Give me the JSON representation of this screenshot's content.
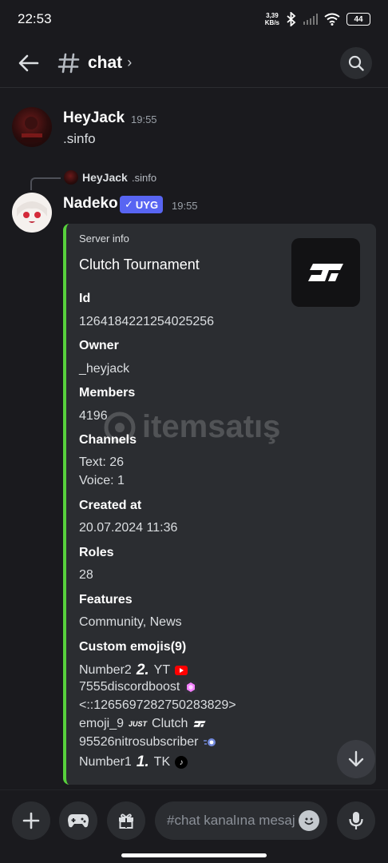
{
  "status_bar": {
    "time": "22:53",
    "net_speed_value": "3,39",
    "net_speed_unit": "KB/s",
    "battery": "44"
  },
  "header": {
    "channel_name": "chat",
    "chevron": "›"
  },
  "messages": {
    "jack": {
      "username": "HeyJack",
      "time": "19:55",
      "text": ".sinfo"
    },
    "reply": {
      "username": "HeyJack",
      "text": ".sinfo"
    },
    "nadeko": {
      "username": "Nadeko",
      "badge": "UYG",
      "badge_check": "✓",
      "time": "19:55"
    }
  },
  "embed": {
    "author": "Server info",
    "title": "Clutch Tournament",
    "fields": {
      "id_name": "Id",
      "id_value": "1264184221254025256",
      "owner_name": "Owner",
      "owner_value": "_heyjack",
      "members_name": "Members",
      "members_value": "4196",
      "channels_name": "Channels",
      "channels_text": "Text: 26",
      "channels_voice": "Voice: 1",
      "created_name": "Created at",
      "created_value": "20.07.2024 11:36",
      "roles_name": "Roles",
      "roles_value": "28",
      "features_name": "Features",
      "features_value": "Community, News",
      "emojis_name": "Custom emojis(9)"
    },
    "emoji_lines": {
      "l1_name": "Number2",
      "l1_glyph": "2.",
      "l1_label": "YT",
      "l2_name": "7555discordboost",
      "l3_text": "<::1265697282750283829>",
      "l4_name": "emoji_9",
      "l4_glyph": "JUST",
      "l4_label": "Clutch",
      "l5_name": "95526nitrosubscriber",
      "l6_name": "Number1",
      "l6_glyph": "1.",
      "l6_label": "TK"
    }
  },
  "watermark": {
    "text": "itemsatış"
  },
  "composer": {
    "placeholder": "#chat kanalına mesaj gönder"
  },
  "colors": {
    "accent": "#5865f2",
    "embed_bar": "#57d13c",
    "background": "#1a1a1e",
    "embed_bg": "#2b2d31"
  },
  "icons": [
    "back-arrow-icon",
    "hash-icon",
    "search-icon",
    "plus-icon",
    "gamepad-icon",
    "gift-icon",
    "emoji-icon",
    "microphone-icon",
    "arrow-down-icon"
  ]
}
